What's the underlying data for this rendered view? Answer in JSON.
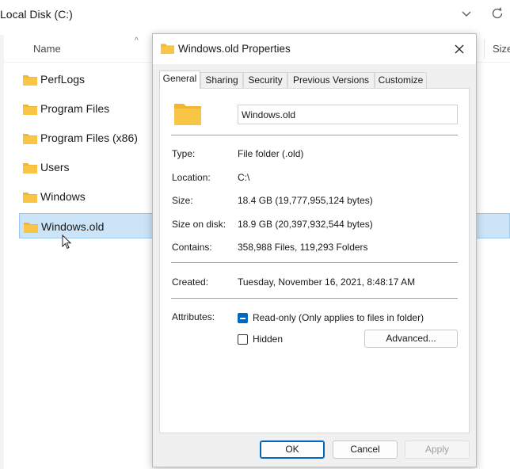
{
  "explorer": {
    "address": "Local Disk (C:)",
    "icons": {
      "dropdown": "chevron-down-icon",
      "refresh": "refresh-icon"
    },
    "columns": {
      "name": "Name",
      "size": "Size"
    },
    "items": [
      {
        "label": "PerfLogs",
        "selected": false
      },
      {
        "label": "Program Files",
        "selected": false
      },
      {
        "label": "Program Files (x86)",
        "selected": false
      },
      {
        "label": "Users",
        "selected": false
      },
      {
        "label": "Windows",
        "selected": false
      },
      {
        "label": "Windows.old",
        "selected": true
      }
    ],
    "folder_color": "#f8c547",
    "selection_color": "#cce4f7"
  },
  "dialog": {
    "title": "Windows.old Properties",
    "close_icon": "close-icon",
    "tabs": [
      {
        "label": "General",
        "active": true
      },
      {
        "label": "Sharing",
        "active": false
      },
      {
        "label": "Security",
        "active": false
      },
      {
        "label": "Previous Versions",
        "active": false
      },
      {
        "label": "Customize",
        "active": false
      }
    ],
    "name_value": "Windows.old",
    "props": {
      "type_label": "Type:",
      "type_value": "File folder (.old)",
      "location_label": "Location:",
      "location_value": "C:\\",
      "size_label": "Size:",
      "size_value": "18.4 GB (19,777,955,124 bytes)",
      "size_on_disk_label": "Size on disk:",
      "size_on_disk_value": "18.9 GB (20,397,932,544 bytes)",
      "contains_label": "Contains:",
      "contains_value": "358,988 Files, 119,293 Folders",
      "created_label": "Created:",
      "created_value": "Tuesday, November 16, 2021, 8:48:17 AM",
      "attributes_label": "Attributes:"
    },
    "attributes": {
      "readonly_label": "Read-only (Only applies to files in folder)",
      "readonly_state": "indeterminate",
      "hidden_label": "Hidden",
      "hidden_checked": false,
      "advanced_label": "Advanced..."
    },
    "buttons": {
      "ok": "OK",
      "cancel": "Cancel",
      "apply": "Apply"
    },
    "accent_color": "#0067c0"
  }
}
